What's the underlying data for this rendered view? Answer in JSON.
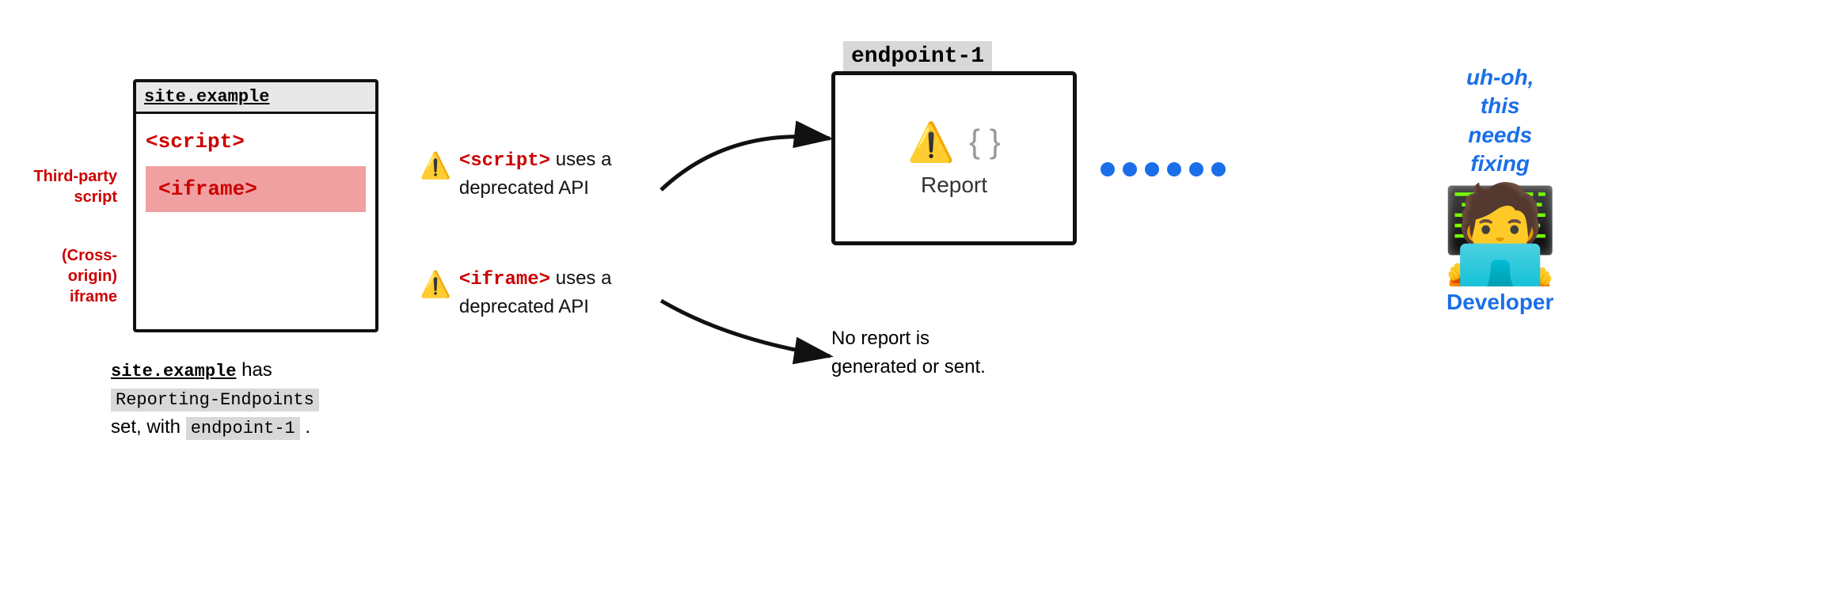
{
  "browser": {
    "title": "site.example",
    "script_tag": "<script>",
    "iframe_tag": "<iframe>"
  },
  "labels": {
    "third_party": "Third-party\nscript",
    "cross_origin": "(Cross-origin)\niframe"
  },
  "description": {
    "part1": "site.example",
    "part2": " has",
    "part3": "Reporting-Endpoints",
    "part4": "set, with ",
    "part5": "endpoint-1",
    "part6": " ."
  },
  "warnings": [
    {
      "icon": "⚠️",
      "tag": "<script>",
      "text": " uses a\ndeprecated API"
    },
    {
      "icon": "⚠️",
      "tag": "<iframe>",
      "text": " uses a\ndeprecated API"
    }
  ],
  "endpoint": {
    "label": "endpoint-1",
    "report_label": "Report"
  },
  "no_report": {
    "text": "No report is\ngenerated or sent."
  },
  "developer": {
    "uh_oh": "uh-oh,\nthis\nneeds\nfixing",
    "label": "Developer"
  },
  "dots": [
    "●",
    "●",
    "●",
    "●",
    "●",
    "●"
  ]
}
